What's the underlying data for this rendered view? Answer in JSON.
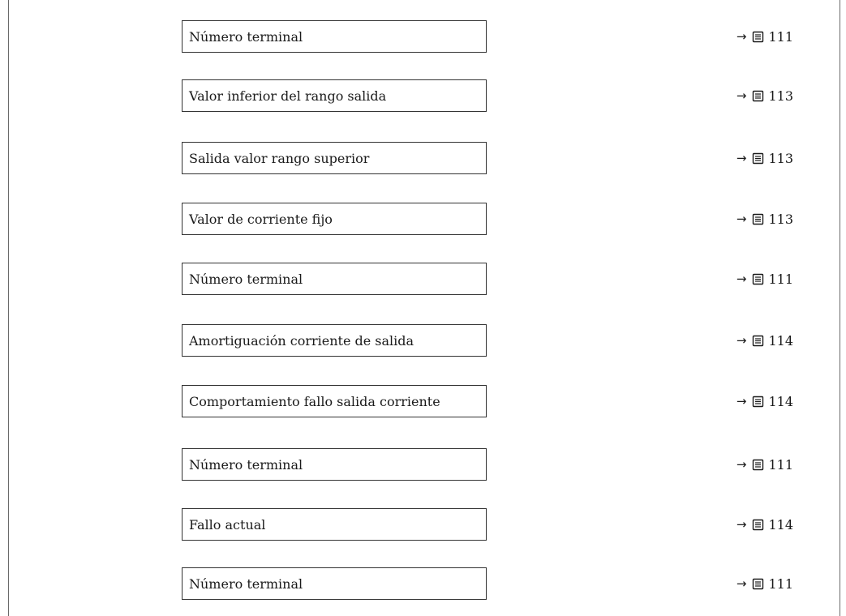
{
  "parameters": [
    {
      "label": "Número terminal",
      "page": "111"
    },
    {
      "label": "Valor inferior del rango salida",
      "page": "113"
    },
    {
      "label": "Salida valor rango superior",
      "page": "113"
    },
    {
      "label": "Valor de corriente fijo",
      "page": "113"
    },
    {
      "label": "Número terminal",
      "page": "111"
    },
    {
      "label": "Amortiguación corriente de salida",
      "page": "114"
    },
    {
      "label": "Comportamiento fallo salida corriente",
      "page": "114"
    },
    {
      "label": "Número terminal",
      "page": "111"
    },
    {
      "label": "Fallo actual",
      "page": "114"
    },
    {
      "label": "Número terminal",
      "page": "111"
    }
  ],
  "ref_arrow": "→",
  "icons": {
    "page_ref": "book-page-icon"
  }
}
